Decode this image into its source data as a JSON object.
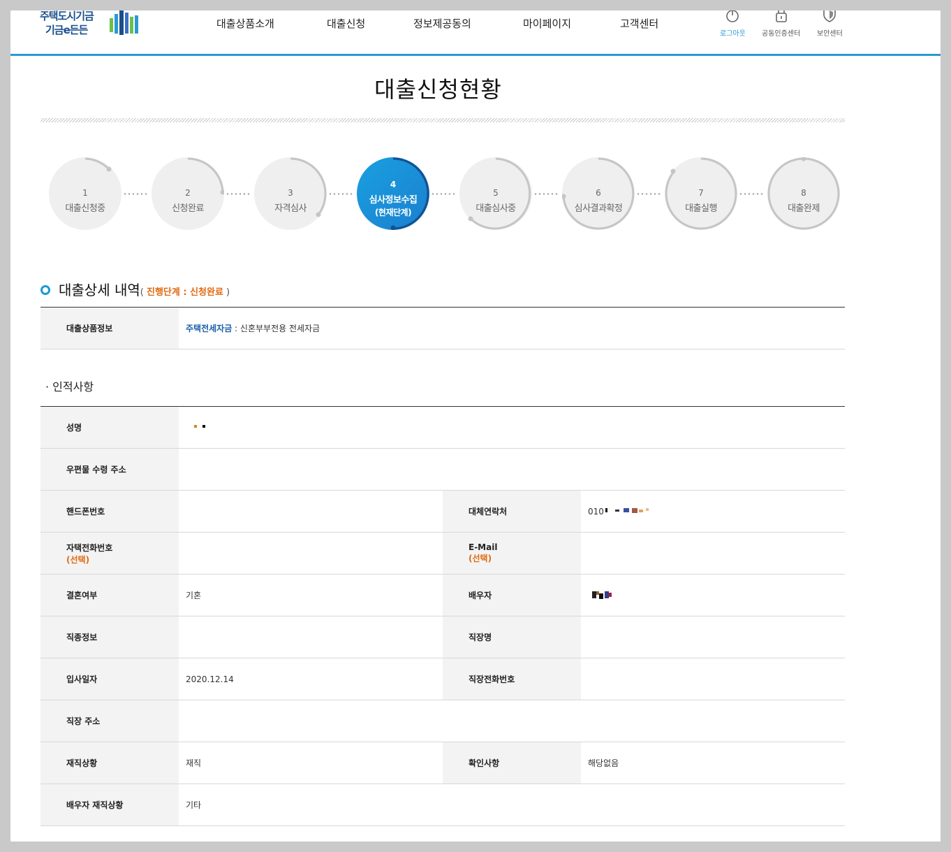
{
  "header": {
    "logo_line1": "주택도시기금",
    "logo_line2": "기금e든든",
    "nav": [
      "대출상품소개",
      "대출신청",
      "정보제공동의",
      "마이페이지",
      "고객센터"
    ],
    "utils": [
      {
        "label": "로그아웃",
        "icon": "power-icon"
      },
      {
        "label": "공동인증센터",
        "icon": "lock-icon"
      },
      {
        "label": "보안센터",
        "icon": "shield-icon"
      }
    ]
  },
  "page_title": "대출신청현황",
  "steps": [
    {
      "num": "1",
      "label": "대출신청중"
    },
    {
      "num": "2",
      "label": "신청완료"
    },
    {
      "num": "3",
      "label": "자격심사"
    },
    {
      "num": "4",
      "label": "심사정보수집",
      "sub": "(현재단계)",
      "current": true
    },
    {
      "num": "5",
      "label": "대출심사중"
    },
    {
      "num": "6",
      "label": "심사결과확정"
    },
    {
      "num": "7",
      "label": "대출실행"
    },
    {
      "num": "8",
      "label": "대출완제"
    }
  ],
  "section": {
    "title": "대출상세 내역",
    "status_open": "( ",
    "status_label": "진행단계 : 신청완료",
    "status_close": " )"
  },
  "product": {
    "label": "대출상품정보",
    "name": "주택전세자금",
    "desc": " : 신혼부부전용 전세자금"
  },
  "personal_title": "· 인적사항",
  "rows": {
    "name_label": "성명",
    "address_label": "우편물 수령 주소",
    "phone_label": "핸드폰번호",
    "alt_phone_label": "대체연락처",
    "alt_phone_value": "010",
    "home_phone_label": "자택전화번호",
    "optional": "(선택)",
    "email_label": "E-Mail",
    "married_label": "결혼여부",
    "married_value": "기혼",
    "spouse_label": "배우자",
    "job_label": "직종정보",
    "company_label": "직장명",
    "join_date_label": "입사일자",
    "join_date_value": "2020.12.14",
    "company_phone_label": "직장전화번호",
    "company_address_label": "직장 주소",
    "employment_label": "재직상황",
    "employment_value": "재직",
    "confirm_label": "확인사항",
    "confirm_value": "해당없음",
    "spouse_employment_label": "배우자 재직상황",
    "spouse_employment_value": "기타"
  },
  "colors": {
    "accent": "#2a9ad4",
    "orange": "#e06a10",
    "blue": "#1a5fa8"
  }
}
